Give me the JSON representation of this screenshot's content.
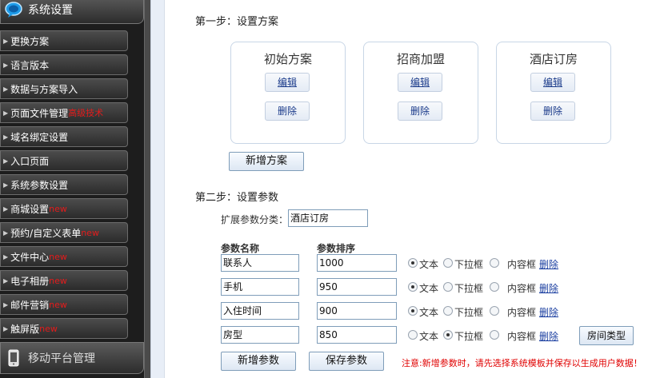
{
  "sidebar": {
    "section_title": "系统设置",
    "items": [
      {
        "label": "更换方案",
        "tag": ""
      },
      {
        "label": "语言版本",
        "tag": ""
      },
      {
        "label": "数据与方案导入",
        "tag": ""
      },
      {
        "label": "页面文件管理",
        "tag": "高级技术"
      },
      {
        "label": "域名绑定设置",
        "tag": ""
      },
      {
        "label": "入口页面",
        "tag": ""
      },
      {
        "label": "系统参数设置",
        "tag": ""
      },
      {
        "label": "商城设置",
        "tag": "new"
      },
      {
        "label": "预约/自定义表单",
        "tag": "new"
      },
      {
        "label": "文件中心",
        "tag": "new"
      },
      {
        "label": "电子相册",
        "tag": "new"
      },
      {
        "label": "邮件营销",
        "tag": "new"
      },
      {
        "label": "触屏版",
        "tag": "new"
      }
    ],
    "mobile_section_title": "移动平台管理"
  },
  "step1": {
    "title": "第一步：设置方案",
    "cards": [
      {
        "title": "初始方案",
        "edit": "编辑",
        "delete": "删除"
      },
      {
        "title": "招商加盟",
        "edit": "编辑",
        "delete": "删除"
      },
      {
        "title": "酒店订房",
        "edit": "编辑",
        "delete": "删除"
      }
    ],
    "add_button": "新增方案"
  },
  "step2": {
    "title": "第二步：设置参数",
    "category_label": "扩展参数分类：",
    "category_value": "酒店订房",
    "col_name": "参数名称",
    "col_order": "参数排序",
    "rows": [
      {
        "name": "联系人",
        "order": "1000",
        "selected": "text",
        "extra_button": ""
      },
      {
        "name": "手机",
        "order": "950",
        "selected": "text",
        "extra_button": ""
      },
      {
        "name": "入住时间",
        "order": "900",
        "selected": "text",
        "extra_button": ""
      },
      {
        "name": "房型",
        "order": "850",
        "selected": "dropdown",
        "extra_button": "房间类型"
      }
    ],
    "opt_text": "文本",
    "opt_dropdown": "下拉框",
    "opt_content": "内容框",
    "delete_label": "删除",
    "add_param_button": "新增参数",
    "save_param_button": "保存参数",
    "note": "注意:新增参数时，请先选择系统模板并保存以生成用户数据！"
  },
  "colors": {
    "sidebar_bg": "#1d1d1d",
    "tag_red": "#e41b1b",
    "link_blue": "#1a3ea0",
    "note_red": "#e00000"
  }
}
